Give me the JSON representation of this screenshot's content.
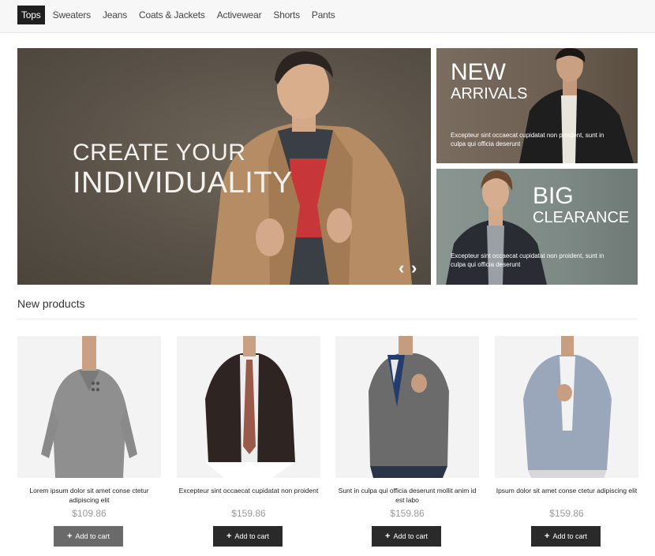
{
  "nav": {
    "items": [
      "Tops",
      "Sweaters",
      "Jeans",
      "Coats & Jackets",
      "Activewear",
      "Shorts",
      "Pants"
    ],
    "active_index": 0
  },
  "hero": {
    "line1": "CREATE YOUR",
    "line2": "INDIVIDUALITY"
  },
  "promos": [
    {
      "title_big": "NEW",
      "title_small": "ARRIVALS",
      "text": "Excepteur sint occaecat cupidatat non proident, sunt in culpa qui officia deserunt"
    },
    {
      "title_big": "BIG",
      "title_small": "CLEARANCE",
      "text": "Excepteur sint occaecat cupidatat non proident, sunt in culpa qui officia deserunt"
    }
  ],
  "section": {
    "title": "New products"
  },
  "products": [
    {
      "name": "Lorem ipsum dolor sit amet conse ctetur adipiscing elit",
      "price": "$109.86",
      "cart_label": "Add to cart"
    },
    {
      "name": "Excepteur sint occaecat cupidatat non proident",
      "price": "$159.86",
      "cart_label": "Add to cart"
    },
    {
      "name": "Sunt in culpa qui officia deserunt mollit anim id est labo",
      "price": "$159.86",
      "cart_label": "Add to cart"
    },
    {
      "name": "Ipsum dolor sit amet conse ctetur adipiscing elit",
      "price": "$159.86",
      "cart_label": "Add to cart"
    }
  ],
  "colors": {
    "nav_active": "#1f1f1f",
    "button": "#2a2a2a",
    "price": "#999999"
  }
}
